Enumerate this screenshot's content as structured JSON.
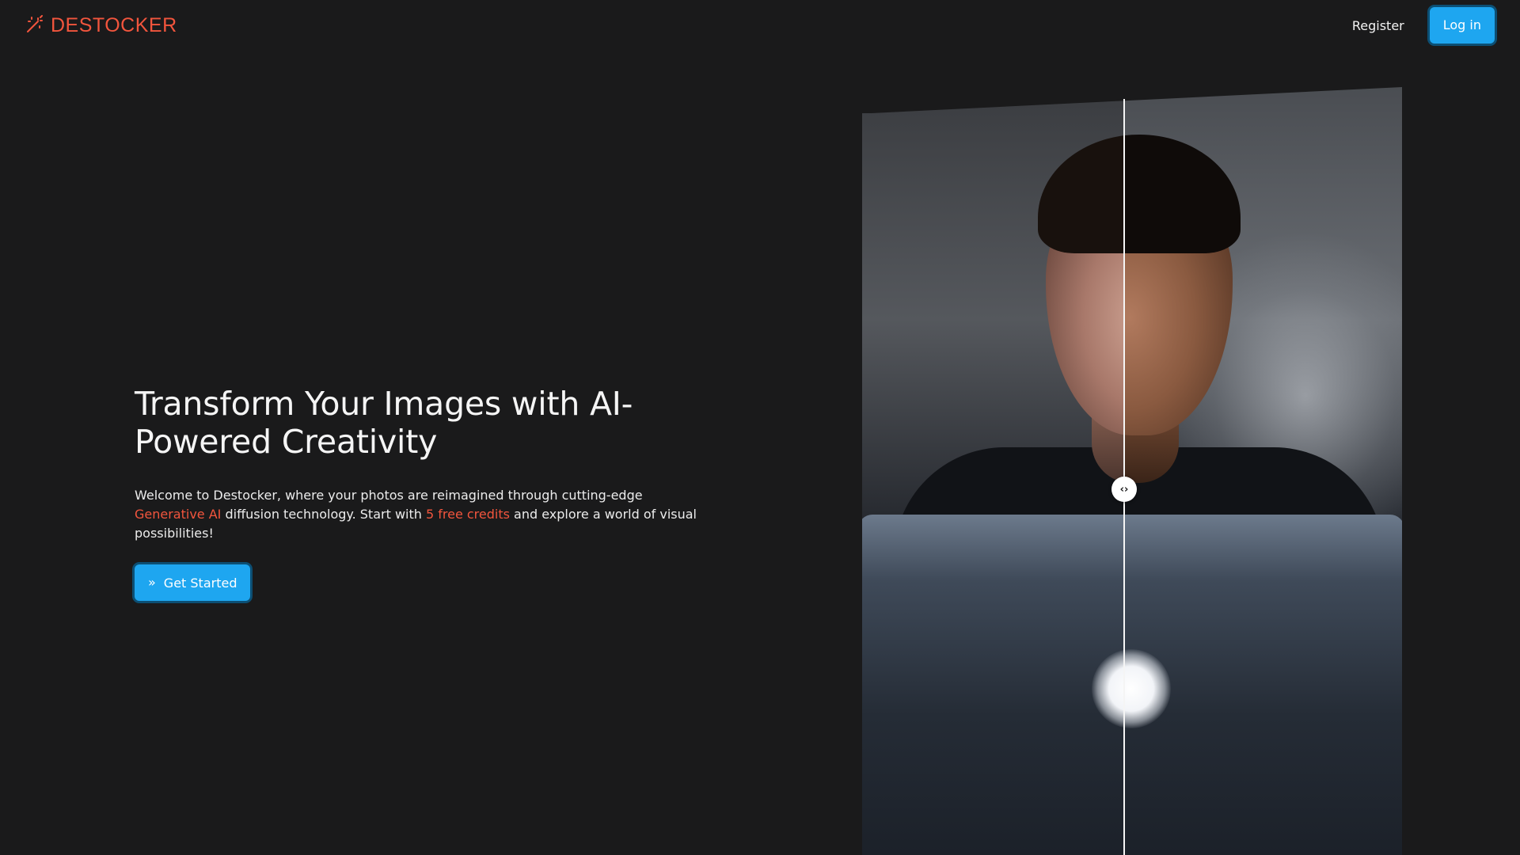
{
  "header": {
    "brand": "DESTOCKER",
    "logo_icon": "magic-wand-icon",
    "register_label": "Register",
    "login_label": "Log in"
  },
  "hero": {
    "title": "Transform Your Images with AI-Powered Creativity",
    "description": {
      "part1": "Welcome to Destocker, where your photos are reimagined through cutting-edge ",
      "highlight1": "Generative AI",
      "part2": " diffusion technology. Start with ",
      "highlight2": "5 free credits",
      "part3": " and explore a world of visual possibilities!"
    },
    "cta_label": "Get Started",
    "cta_icon": "chevrons-right-icon"
  },
  "compare": {
    "handle_icon": "code-arrows-icon",
    "split_fraction": 0.485
  },
  "colors": {
    "background": "#1a1a1b",
    "accent": "#f2553d",
    "primary_button": "#1ea6f0"
  }
}
